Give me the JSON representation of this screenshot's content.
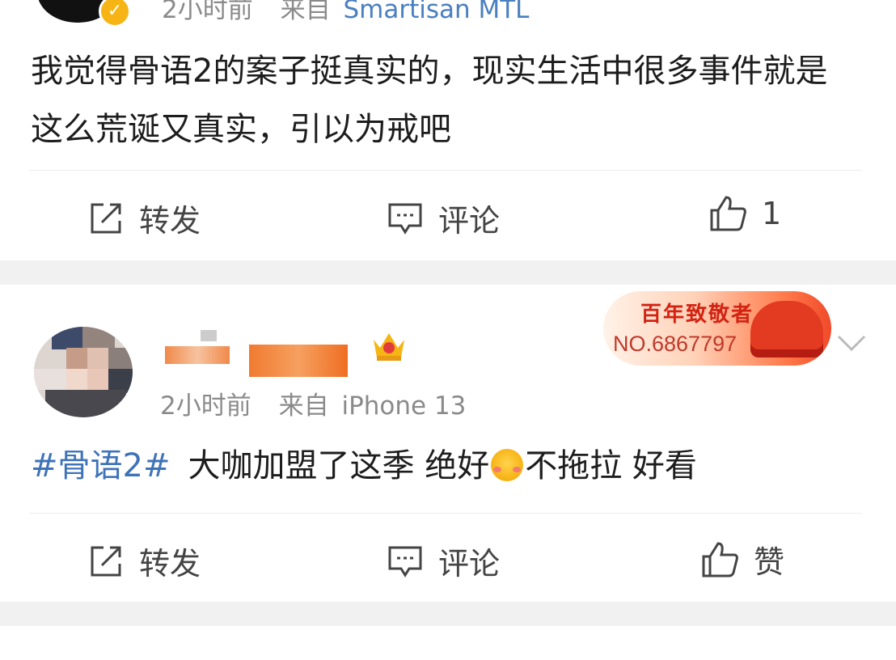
{
  "post1": {
    "time": "2小时前",
    "source_prefix": "来自",
    "source_device": "Smartisan MTL",
    "text": "我觉得骨语2的案子挺真实的，现实生活中很多事件就是这么荒诞又真实，引以为戒吧",
    "actions": {
      "repost": "转发",
      "comment": "评论",
      "like": "1"
    }
  },
  "post2": {
    "time": "2小时前",
    "source_prefix": "来自",
    "source_device": "iPhone 13",
    "hashtag": "#骨语2#",
    "text_before_emoji": "大咖加盟了这季 绝好",
    "text_after_emoji": "不拖拉 好看",
    "medal": {
      "title": "百年致敬者",
      "number": "NO.6867797"
    },
    "actions": {
      "repost": "转发",
      "comment": "评论",
      "like": "赞"
    }
  },
  "colors": {
    "link": "#3e73b8",
    "meta": "#8a8a8a",
    "divider": "#f1f1f1"
  },
  "icons": [
    "verified-badge-icon",
    "repost-icon",
    "comment-icon",
    "like-icon",
    "crown-icon",
    "chevron-down-icon",
    "blush-emoji-icon"
  ]
}
